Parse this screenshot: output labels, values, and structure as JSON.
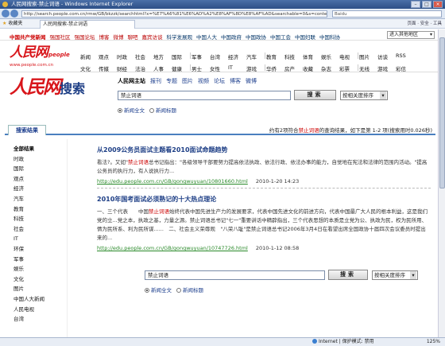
{
  "window": {
    "title": "人民网搜索-禁止词语 - Windows Internet Explorer",
    "address": "http://search.people.com.cn/rmw/GB/bkzzk/searchhtml?x=%E7%A6%81%E6%AD%A2%E8%AF%8D%E8%AF%AD&searchable=0&s=content",
    "search_engine": "Baidu",
    "favorites_label": "收藏夹",
    "tab_label": "人民网搜索-禁止词语",
    "tools": "页面 · 安全 · 工具"
  },
  "site_nav": {
    "links": [
      "中国共产党新闻",
      "强国社区",
      "强国论坛",
      "博客",
      "微博",
      "聊吧",
      "嘉宾访谈",
      "科学发展观",
      "中国人大",
      "中国政府",
      "中国政协",
      "中国工会",
      "中国妇联",
      "中国科协"
    ],
    "site_select": "进入其他地区 "
  },
  "header": {
    "logo_text": "人民网",
    "logo_suffix": "people",
    "logo_url": "www.people.com.cn",
    "channels_row1": [
      "新闻",
      "观点",
      "时政",
      "社会",
      "地方",
      "国际",
      "军事",
      "台湾",
      "经济",
      "汽车",
      "教育",
      "科技",
      "体育",
      "娱乐",
      "电视",
      "图片",
      "访谈",
      "RSS"
    ],
    "channels_row2": [
      "文化",
      "传媒",
      "财经",
      "法治",
      "人事",
      "健康",
      "男士",
      "女性",
      "IT",
      "游戏",
      "华侨",
      "房产",
      "收藏",
      "杂志",
      "彩票",
      "无线",
      "游戏",
      "彩信"
    ]
  },
  "search": {
    "logo_text": "人民网",
    "logo_suffix": "搜索",
    "tabs": [
      "人民网主站",
      "报刊",
      "专题",
      "图片",
      "视频",
      "论坛",
      "博客",
      "微博"
    ],
    "query": "禁止词语",
    "button": "搜索",
    "sort": "按相关度排序",
    "radio_fulltext": "新闻全文",
    "radio_title": "新闻标题"
  },
  "results_header": {
    "tab": "搜索结果",
    "info_prefix": "约有2项符合",
    "keyword": "禁止词语",
    "info_suffix": "的查询结果，如下是第 1-2 项(搜索用时0.026秒)"
  },
  "filters": {
    "heading": "全部结果",
    "items": [
      "时政",
      "国际",
      "观点",
      "经济",
      "汽车",
      "教育",
      "科技",
      "社会",
      "IT",
      "环保",
      "军事",
      "娱乐",
      "文化",
      "图片",
      "中国人大新闻",
      "人民电视",
      "台湾"
    ]
  },
  "results": [
    {
      "title_a": "从2009公务员面试主题看",
      "title_hl": "2010面试命题",
      "title_b": "趋势",
      "snippet_a": "看法?。又如\"",
      "snippet_hl": "禁止词语",
      "snippet_b": "总书记指出：\"各级领导干部要努力提高依法执政、依法行政、依法办事的能力，自觉地在宪法和法律的范围内活动。\"提高公务员的执行力，有人说执行力...",
      "url": "http://edu.people.com.cn/GB/gongwuyuan/10801660.html",
      "date": "2010-1-20 14:23"
    },
    {
      "title_a": "2010年国考面试必须熟记的十大热点",
      "title_hl": "理论",
      "title_b": "",
      "snippet_a": "一、三个代表　　中国",
      "snippet_hl": "禁止词语",
      "snippet_b": "始终代表中国先进生产力的发展要求，代表中国先进文化的前进方向，代表中国最广大人民的根本利益，这是我们党的立...党之本，执政之基，力量之源。禁止词语总书记\"七一\"重要讲话中精辟指出，三个代表思想的本质是立党为公、执政为民，权为民所用、情为民所系、利为民所谋......　二、社会主义荣辱观　\"八荣八耻\"是禁止词语总书记2006年3月4日在看望出席全国政协十届四次会议委员时提出来的...",
      "url": "http://edu.people.com.cn/GB/gongwuyuan/10747726.html",
      "date": "2010-1-12 08:58"
    }
  ],
  "status": {
    "zone": "Internet | 保护模式: 禁用",
    "zoom": "125%"
  },
  "colors": {
    "brand_red": "#d8161b",
    "link_blue": "#1e3f86",
    "url_green": "#2a8a2a",
    "accent_bar": "#4a7fbf"
  }
}
